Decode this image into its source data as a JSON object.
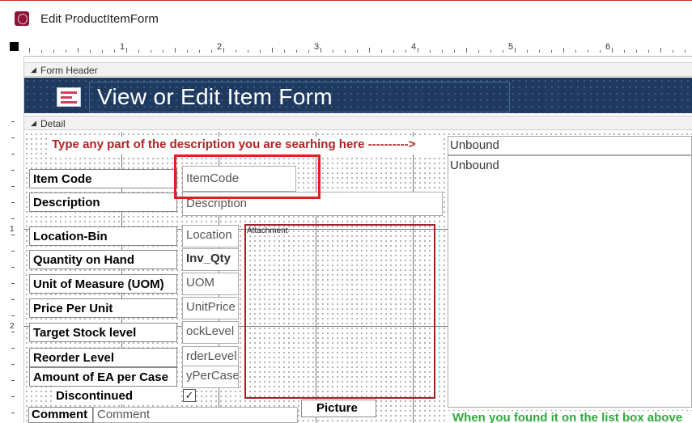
{
  "window": {
    "title": "Edit ProductItemForm"
  },
  "ruler": {
    "numbers": [
      "1",
      "2",
      "3",
      "4",
      "5",
      "6"
    ],
    "vertical_numbers": [
      "1",
      "2"
    ]
  },
  "sections": {
    "form_header": "Form Header",
    "detail": "Detail"
  },
  "header": {
    "title": "View or Edit Item Form"
  },
  "detail": {
    "search_hint": "Type any part of the description you are searhing here ---------->",
    "unbound_1": "Unbound",
    "unbound_2": "Unbound",
    "fields": [
      {
        "label": "Item Code",
        "value": "ItemCode"
      },
      {
        "label": "Description",
        "value": "Description"
      },
      {
        "label": "Location-Bin",
        "value": "Location"
      },
      {
        "label": "Quantity on Hand",
        "value": "Inv_Qty"
      },
      {
        "label": "Unit of Measure (UOM)",
        "value": "UOM"
      },
      {
        "label": "Price Per Unit",
        "value": "UnitPrice"
      },
      {
        "label": "Target Stock level",
        "value": "ockLevel"
      },
      {
        "label": "Reorder Level",
        "value": "rderLevel"
      },
      {
        "label": "Amount of EA per Case",
        "value": "yPerCase"
      }
    ],
    "discontinued_label": "Discontinued",
    "discontinued_checked": "✓",
    "attachment_label": "Attachment",
    "picture_label": "Picture",
    "comment_label": "Comment",
    "comment_value": "Comment",
    "green_hint": "When you found it on the list box above"
  },
  "colors": {
    "header_band": "#1f3a5f",
    "highlight": "#e02020",
    "hint_red": "#b22222",
    "hint_green": "#2eaa3c"
  }
}
